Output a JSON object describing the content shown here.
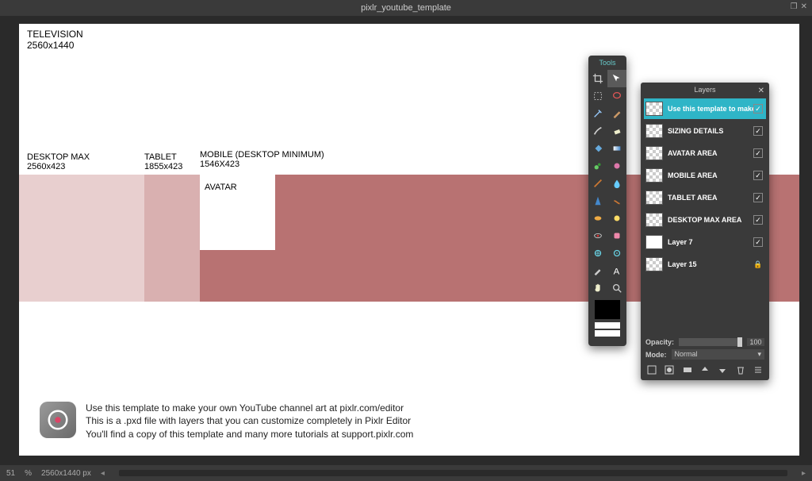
{
  "title": "pixlr_youtube_template",
  "canvas": {
    "tv": {
      "label": "TELEVISION",
      "dim": "2560x1440"
    },
    "desktop": {
      "label": "DESKTOP MAX",
      "dim": "2560x423"
    },
    "tablet": {
      "label": "TABLET",
      "dim": "1855x423"
    },
    "mobile": {
      "label": "MOBILE (DESKTOP MINIMUM)",
      "dim": "1546X423"
    },
    "avatar": "AVATAR"
  },
  "footer": {
    "line1": "Use this template to make your own YouTube channel art at pixlr.com/editor",
    "line2": "This is a .pxd file with layers that you can customize completely in Pixlr Editor",
    "line3": "You'll find a copy of this template and many more tutorials at support.pixlr.com"
  },
  "status": {
    "zoom": "51",
    "zoom_unit": "%",
    "dim": "2560x1440 px"
  },
  "tools": {
    "title": "Tools"
  },
  "layers": {
    "title": "Layers",
    "items": [
      {
        "name": "Use this template to make you",
        "visible": true,
        "active": true,
        "thumb": "checker"
      },
      {
        "name": "SIZING DETAILS",
        "visible": true,
        "thumb": "checker"
      },
      {
        "name": "AVATAR AREA",
        "visible": true,
        "thumb": "checker"
      },
      {
        "name": "MOBILE AREA",
        "visible": true,
        "thumb": "checker"
      },
      {
        "name": "TABLET AREA",
        "visible": true,
        "thumb": "checker"
      },
      {
        "name": "DESKTOP MAX AREA",
        "visible": true,
        "thumb": "checker"
      },
      {
        "name": "Layer 7",
        "visible": true,
        "thumb": "solid"
      },
      {
        "name": "Layer 15",
        "locked": true,
        "thumb": "checker"
      }
    ],
    "opacity_label": "Opacity:",
    "opacity_value": "100",
    "mode_label": "Mode:",
    "mode_value": "Normal"
  }
}
